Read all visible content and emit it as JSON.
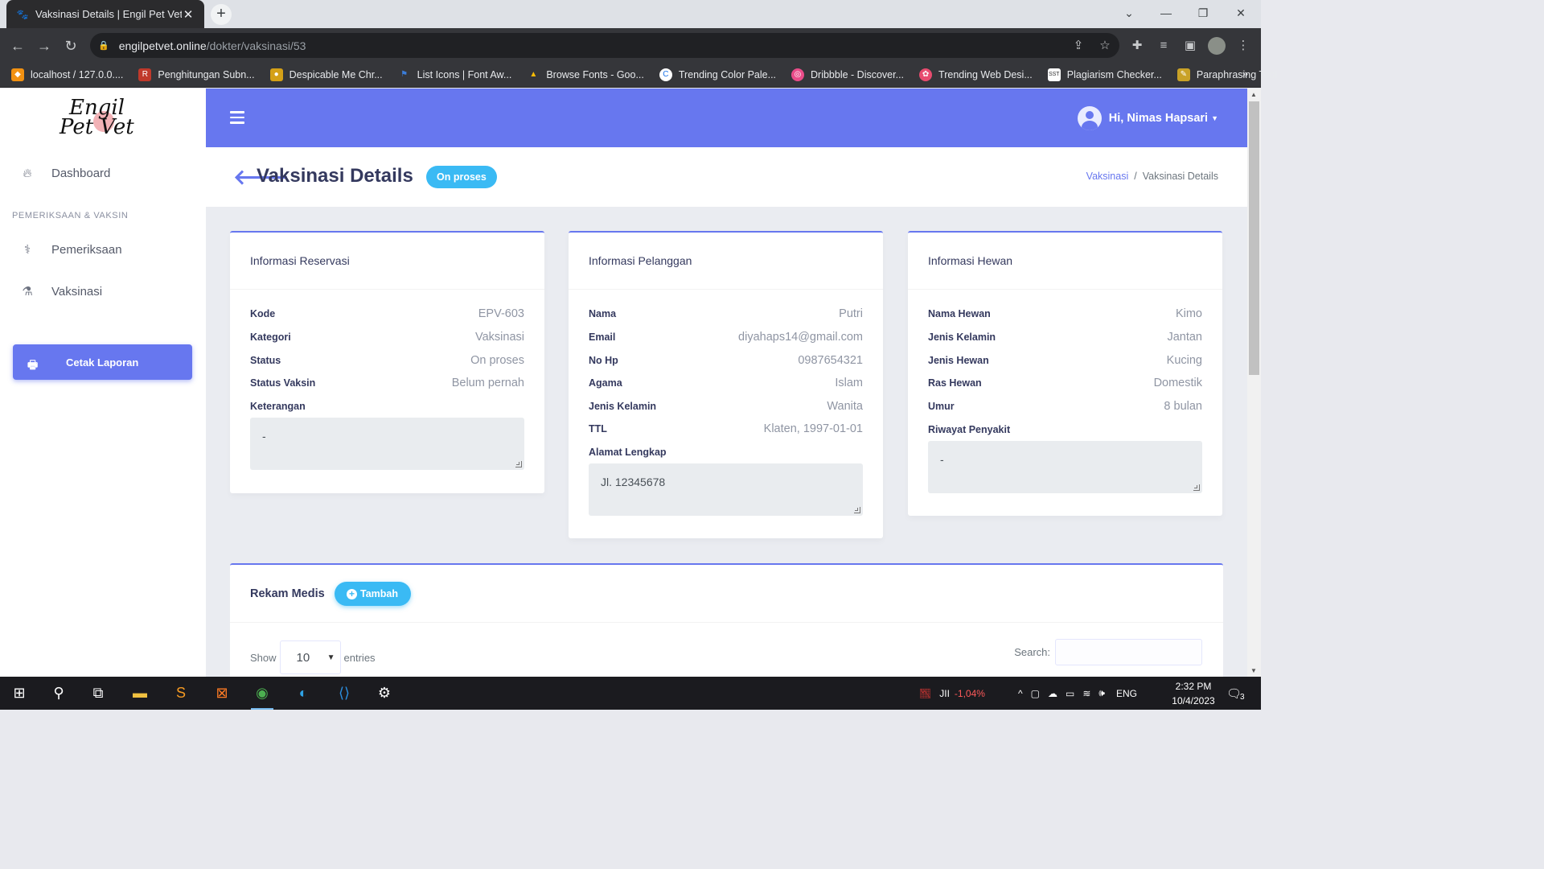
{
  "browser": {
    "tab_title": "Vaksinasi Details | Engil Pet Vet",
    "url_domain": "engilpetvet.online",
    "url_path": "/dokter/vaksinasi/53",
    "bookmarks": [
      {
        "label": "localhost / 127.0.0....",
        "color": "#f29111"
      },
      {
        "label": "Penghitungan Subn...",
        "color": "#c0392b"
      },
      {
        "label": "Despicable Me Chr...",
        "color": "#d4a017"
      },
      {
        "label": "List Icons | Font Aw...",
        "color": "#3b7dd8"
      },
      {
        "label": "Browse Fonts - Goo...",
        "color": "#fbbc05"
      },
      {
        "label": "Trending Color Pale...",
        "color": "#1a73e8"
      },
      {
        "label": "Dribbble - Discover...",
        "color": "#ea4c89"
      },
      {
        "label": "Trending Web Desi...",
        "color": "#e84c6f"
      },
      {
        "label": "Plagiarism Checker...",
        "color": "#ffffff"
      },
      {
        "label": "Paraphrasing Tool",
        "color": "#c9a227"
      }
    ]
  },
  "sidebar": {
    "logo_line1": "Engil",
    "logo_line2": "Pet Vet",
    "dashboard": "Dashboard",
    "section_heading": "PEMERIKSAAN & VAKSIN",
    "pemeriksaan": "Pemeriksaan",
    "vaksinasi": "Vaksinasi",
    "print_button": "Cetak Laporan"
  },
  "topnav": {
    "user_greeting": "Hi, Nimas Hapsari"
  },
  "header": {
    "title": "Vaksinasi Details",
    "status": "On proses",
    "breadcrumb_link": "Vaksinasi",
    "breadcrumb_current": "Vaksinasi Details"
  },
  "reservasi": {
    "title": "Informasi Reservasi",
    "rows": [
      {
        "k": "Kode",
        "v": "EPV-603"
      },
      {
        "k": "Kategori",
        "v": "Vaksinasi"
      },
      {
        "k": "Status",
        "v": "On proses"
      },
      {
        "k": "Status Vaksin",
        "v": "Belum pernah"
      }
    ],
    "keterangan_label": "Keterangan",
    "keterangan_value": "-"
  },
  "pelanggan": {
    "title": "Informasi Pelanggan",
    "rows": [
      {
        "k": "Nama",
        "v": "Putri"
      },
      {
        "k": "Email",
        "v": "diyahaps14@gmail.com"
      },
      {
        "k": "No Hp",
        "v": "0987654321"
      },
      {
        "k": "Agama",
        "v": "Islam"
      },
      {
        "k": "Jenis Kelamin",
        "v": "Wanita"
      },
      {
        "k": "TTL",
        "v": "Klaten, 1997-01-01"
      }
    ],
    "alamat_label": "Alamat Lengkap",
    "alamat_value": "Jl. 12345678"
  },
  "hewan": {
    "title": "Informasi Hewan",
    "rows": [
      {
        "k": "Nama Hewan",
        "v": "Kimo"
      },
      {
        "k": "Jenis Kelamin",
        "v": "Jantan"
      },
      {
        "k": "Jenis Hewan",
        "v": "Kucing"
      },
      {
        "k": "Ras Hewan",
        "v": "Domestik"
      },
      {
        "k": "Umur",
        "v": "8 bulan"
      }
    ],
    "riwayat_label": "Riwayat Penyakit",
    "riwayat_value": "-"
  },
  "rekam_medis": {
    "title": "Rekam Medis",
    "add_button": "Tambah",
    "show_label": "Show",
    "entries_value": "10",
    "entries_label": "entries",
    "search_label": "Search:"
  },
  "taskbar": {
    "stock_value": "-1,04%",
    "language": "ENG",
    "time": "2:32 PM",
    "date": "10/4/2023",
    "notifications": "3"
  }
}
